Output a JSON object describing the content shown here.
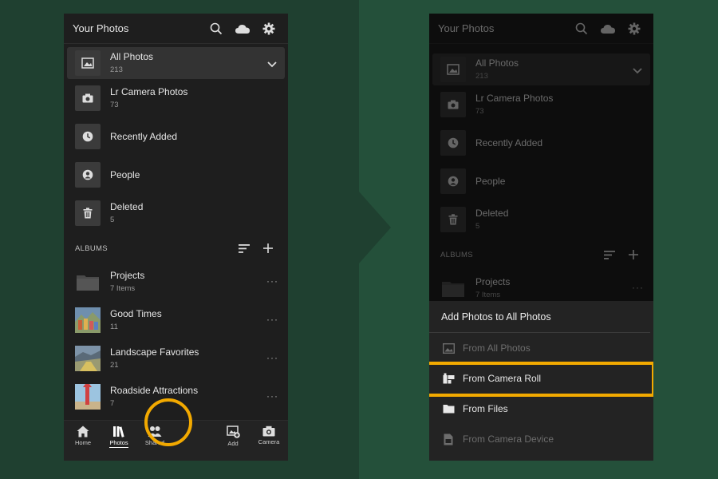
{
  "header": {
    "title": "Your Photos"
  },
  "sources": [
    {
      "label": "All Photos",
      "count": "213",
      "icon": "image-icon"
    },
    {
      "label": "Lr Camera Photos",
      "count": "73",
      "icon": "camera-icon"
    },
    {
      "label": "Recently Added",
      "count": "",
      "icon": "clock-icon"
    },
    {
      "label": "People",
      "count": "",
      "icon": "person-icon"
    },
    {
      "label": "Deleted",
      "count": "5",
      "icon": "trash-icon"
    }
  ],
  "albums": {
    "label": "ALBUMS",
    "items": [
      {
        "label": "Projects",
        "count": "7 Items",
        "icon": "folder-icon"
      },
      {
        "label": "Good Times",
        "count": "11",
        "icon": "album-thumbnail"
      },
      {
        "label": "Landscape Favorites",
        "count": "21",
        "icon": "album-thumbnail"
      },
      {
        "label": "Roadside Attractions",
        "count": "7",
        "icon": "album-thumbnail"
      }
    ]
  },
  "nav": [
    {
      "label": "Home",
      "icon": "home-icon"
    },
    {
      "label": "Photos",
      "icon": "photos-icon"
    },
    {
      "label": "Shared",
      "icon": "shared-icon"
    },
    {
      "label": "Add",
      "icon": "add-photo-icon"
    },
    {
      "label": "Camera",
      "icon": "camera-icon"
    }
  ],
  "sheet": {
    "title": "Add Photos to All Photos",
    "options": [
      {
        "label": "From All Photos",
        "enabled": false,
        "icon": "image-icon"
      },
      {
        "label": "From Camera Roll",
        "enabled": true,
        "icon": "camera-roll-icon"
      },
      {
        "label": "From Files",
        "enabled": true,
        "icon": "folder-icon"
      },
      {
        "label": "From Camera Device",
        "enabled": false,
        "icon": "device-icon"
      }
    ]
  },
  "colors": {
    "highlight": "#f2a900",
    "panel": "#1e1e1e",
    "background": "#1f4030"
  }
}
